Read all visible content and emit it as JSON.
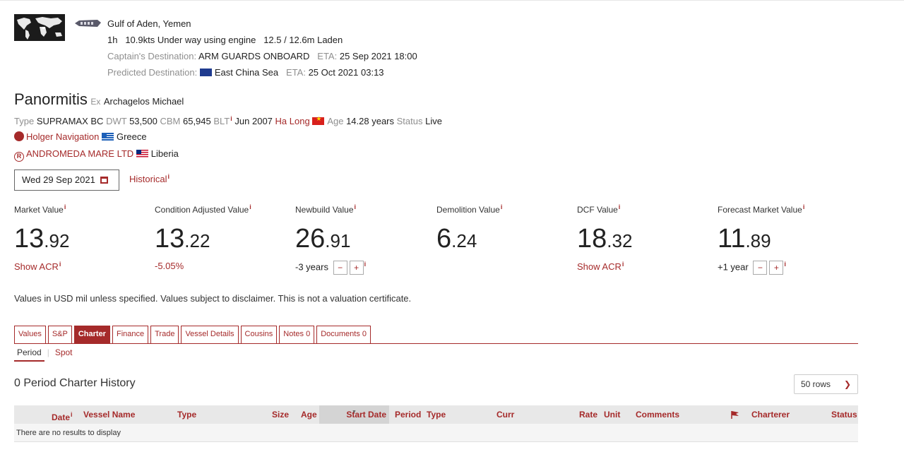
{
  "position": {
    "location": "Gulf of Aden, Yemen",
    "age": "1h",
    "speed": "10.9kts",
    "nav_status": "Under way using engine",
    "draught": "12.5 / 12.6m",
    "load_status": "Laden",
    "captain_label": "Captain's Destination:",
    "captain_dest": "ARM GUARDS ONBOARD",
    "captain_eta_label": "ETA:",
    "captain_eta": "25 Sep 2021 18:00",
    "predicted_label": "Predicted Destination:",
    "predicted_dest": "East China Sea",
    "predicted_eta_label": "ETA:",
    "predicted_eta": "25 Oct 2021 03:13"
  },
  "vessel": {
    "name": "Panormitis",
    "ex_label": "Ex",
    "ex_name": "Archagelos Michael"
  },
  "specs": {
    "type_label": "Type",
    "type": "SUPRAMAX BC",
    "dwt_label": "DWT",
    "dwt": "53,500",
    "cbm_label": "CBM",
    "cbm": "65,945",
    "blt_label": "BLT",
    "blt": "Jun 2007",
    "builder": "Ha Long",
    "age_label": "Age",
    "age": "14.28 years",
    "status_label": "Status",
    "status": "Live"
  },
  "owner": {
    "name": "Holger Navigation",
    "country": "Greece"
  },
  "registered_owner": {
    "name": "ANDROMEDA MARE LTD",
    "country": "Liberia"
  },
  "date_picker": {
    "value": "Wed 29 Sep 2021"
  },
  "historical_label": "Historical",
  "info_glyph": "i",
  "values": [
    {
      "label": "Market Value",
      "int": "13",
      "dec": ".92",
      "foot": "Show ACR"
    },
    {
      "label": "Condition Adjusted Value",
      "int": "13",
      "dec": ".22",
      "foot": "-5.05%"
    },
    {
      "label": "Newbuild Value",
      "int": "26",
      "dec": ".91",
      "foot": "-3 years"
    },
    {
      "label": "Demolition Value",
      "int": "6",
      "dec": ".24",
      "foot": ""
    },
    {
      "label": "DCF Value",
      "int": "18",
      "dec": ".32",
      "foot": "Show ACR"
    },
    {
      "label": "Forecast Market Value",
      "int": "11",
      "dec": ".89",
      "foot": "+1 year"
    }
  ],
  "stepper": {
    "minus": "−",
    "plus": "+"
  },
  "disclaimer": "Values in USD mil unless specified. Values subject to disclaimer. This is not a valuation certificate.",
  "tabs": [
    "Values",
    "S&P",
    "Charter",
    "Finance",
    "Trade",
    "Vessel Details",
    "Cousins",
    "Notes 0",
    "Documents 0"
  ],
  "active_tab": "Charter",
  "subtabs": [
    "Period",
    "Spot"
  ],
  "history_title": "0 Period Charter History",
  "rows_select": "50 rows",
  "table": {
    "columns": [
      "Date",
      "Vessel Name",
      "Type",
      "Size",
      "Age",
      "Start Date",
      "Period",
      "Type",
      "Curr",
      "Rate",
      "Unit",
      "Comments",
      "Charterer",
      "Status"
    ],
    "empty_text": "There are no results to display"
  },
  "colors": {
    "accent": "#a52a2a",
    "header_bg": "#e8e8e8"
  }
}
